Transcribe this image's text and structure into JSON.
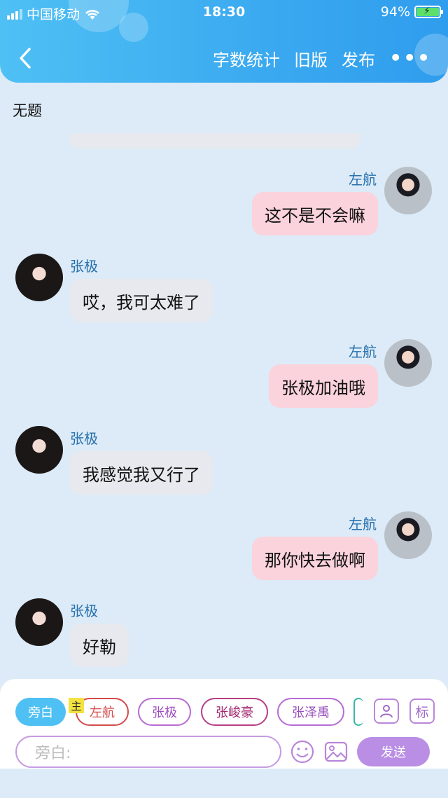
{
  "status_bar": {
    "carrier": "中国移动",
    "time": "18:30",
    "battery": "94%"
  },
  "nav": {
    "actions": [
      "字数统计",
      "旧版",
      "发布"
    ],
    "more": "•••"
  },
  "document_title": "无题",
  "messages": [
    {
      "speaker": "左航",
      "side": "right",
      "text": "这不是不会嘛"
    },
    {
      "speaker": "张极",
      "side": "left",
      "text": "哎，我可太难了"
    },
    {
      "speaker": "左航",
      "side": "right",
      "text": "张极加油哦"
    },
    {
      "speaker": "张极",
      "side": "left",
      "text": "我感觉我又行了"
    },
    {
      "speaker": "左航",
      "side": "right",
      "text": "那你快去做啊"
    },
    {
      "speaker": "张极",
      "side": "left",
      "text": "好勒"
    }
  ],
  "characters": {
    "active": "旁白",
    "host_badge": "主",
    "list": [
      "左航",
      "张极",
      "张峻豪",
      "张泽禹"
    ]
  },
  "toolbar": {
    "tag_button": "标"
  },
  "composer": {
    "placeholder": "旁白:",
    "send_label": "发送"
  },
  "colors": {
    "header": "#3aa9f0",
    "my_bubble": "#fbd3dc",
    "other_bubble": "#e7e9ee",
    "send": "#b98ee4"
  }
}
